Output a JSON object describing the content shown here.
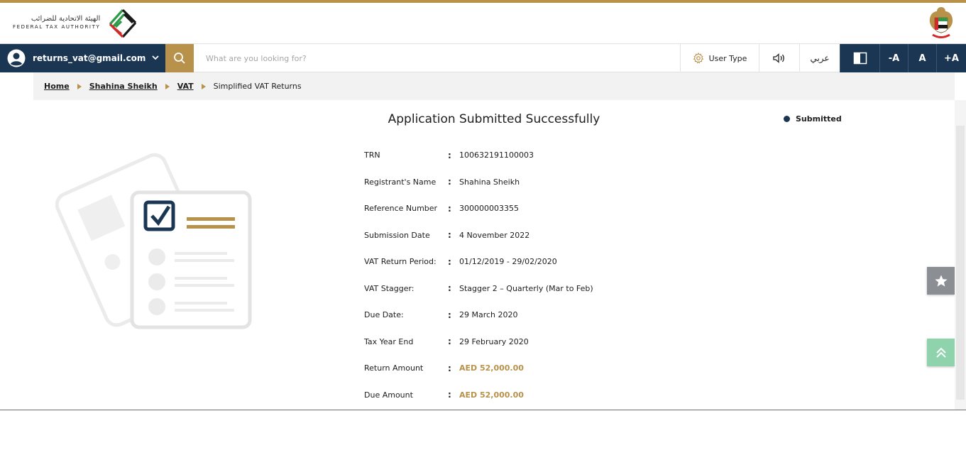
{
  "header": {
    "logo_arabic": "الهيئة الاتحادية للضرائب",
    "logo_english": "FEDERAL TAX AUTHORITY"
  },
  "navbar": {
    "user_email": "returns_vat@gmail.com",
    "search_placeholder": "What are you looking for?",
    "user_type_label": "User Type",
    "arabic_label": "عربي",
    "font_minus": "-A",
    "font_normal": "A",
    "font_plus": "+A"
  },
  "breadcrumb": {
    "items": [
      "Home",
      "Shahina Sheikh",
      "VAT",
      "Simplified VAT Returns"
    ]
  },
  "main": {
    "title": "Application Submitted Successfully",
    "status": "Submitted",
    "details": [
      {
        "label": "TRN",
        "value": "100632191100003"
      },
      {
        "label": "Registrant's Name",
        "value": "Shahina Sheikh"
      },
      {
        "label": "Reference Number",
        "value": "300000003355"
      },
      {
        "label": "Submission Date",
        "value": "4 November 2022"
      },
      {
        "label": "VAT Return Period:",
        "value": "01/12/2019 - 29/02/2020"
      },
      {
        "label": "VAT Stagger:",
        "value": "Stagger 2 – Quarterly (Mar to Feb)"
      },
      {
        "label": "Due Date:",
        "value": "29 March 2020"
      },
      {
        "label": "Tax Year End",
        "value": "29 February 2020"
      },
      {
        "label": "Return Amount",
        "value": "AED 52,000.00"
      },
      {
        "label": "Due Amount",
        "value": "AED 52,000.00"
      }
    ]
  },
  "colors": {
    "navy": "#1b3653",
    "gold": "#b8924a",
    "green_button": "#8fd3ad",
    "grey_button": "#8b8f94"
  },
  "icons": {
    "user": "user-circle-icon",
    "search": "search-icon",
    "settings": "gear-icon",
    "speaker": "speaker-icon",
    "contrast": "contrast-icon",
    "favorite": "star-icon",
    "scroll_top": "double-chevron-up-icon"
  }
}
